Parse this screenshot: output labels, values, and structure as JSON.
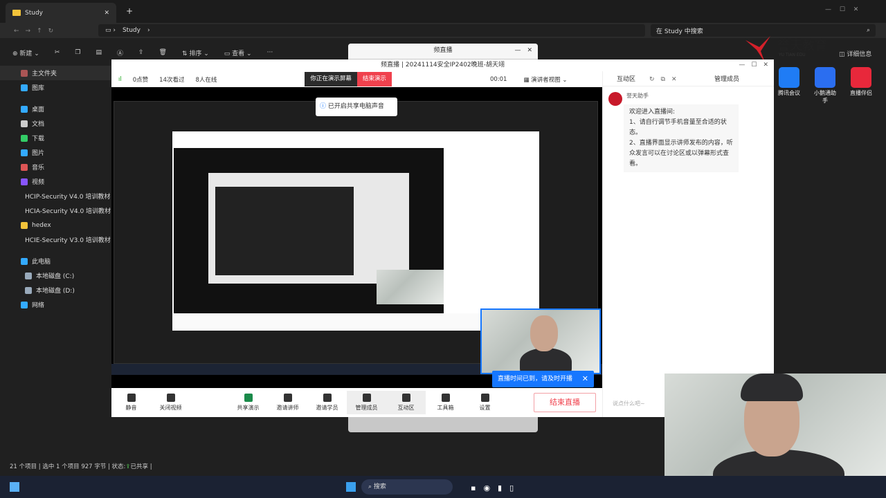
{
  "explorer": {
    "tab_title": "Study",
    "path": [
      "Study"
    ],
    "search_placeholder": "在 Study 中搜索",
    "toolbar": {
      "new": "新建",
      "sort": "排序",
      "view": "查看",
      "more": "···",
      "details": "详细信息"
    },
    "sidebar": [
      "主文件夹",
      "图库",
      "桌面",
      "文档",
      "下载",
      "图片",
      "音乐",
      "视频",
      "HCIP-Security V4.0 培训教材-PP",
      "HCIA-Security V4.0 培训教材 PP",
      "hedex",
      "HCIE-Security V3.0 培训教材-PP",
      "此电脑",
      "本地磁盘 (C:)",
      "本地磁盘 (D:)",
      "网络"
    ],
    "status": {
      "items": "21 个项目",
      "selected": "选中 1 个项目  927 字节",
      "state": "状态:",
      "shared": "已共享"
    }
  },
  "small_window": {
    "title": "频直播"
  },
  "live": {
    "title": "频直播 | 20241114安全IP2402晚班-胡天翊",
    "stats": {
      "likes": "0点赞",
      "views": "14次看过",
      "online": "8人在线"
    },
    "presenting": "你正在演示屏幕",
    "stop_presenting": "结束演示",
    "timer": "00:01",
    "view_mode": "演讲者视图",
    "share_notice": "已开启共享电脑声音",
    "toolbar": [
      {
        "label": "静音",
        "icon": "mic-icon"
      },
      {
        "label": "关闭视频",
        "icon": "camera-icon"
      },
      {
        "label": "共享演示",
        "icon": "share-screen-icon"
      },
      {
        "label": "邀请讲师",
        "icon": "invite-lecturer-icon"
      },
      {
        "label": "邀请学员",
        "icon": "invite-student-icon"
      },
      {
        "label": "管理成员",
        "icon": "members-icon"
      },
      {
        "label": "互动区",
        "icon": "chat-icon"
      },
      {
        "label": "工具箱",
        "icon": "toolbox-icon"
      },
      {
        "label": "设置",
        "icon": "gear-icon"
      }
    ],
    "end_live": "结束直播",
    "popup": "直播时间已到，请及时开播",
    "panel": {
      "tab_interact": "互动区",
      "tab_members": "管理成员",
      "sender": "誉天助手",
      "message": [
        "欢迎进入直播间:",
        "1、请自行调节手机音量至合适的状态。",
        "2、直播界面显示讲师发布的内容，听众发言可以在讨论区或以弹幕形式查看。"
      ],
      "input_placeholder": "说点什么吧~"
    }
  },
  "logo": {
    "text": "誉天教育",
    "sub": "YU TIAN EDU"
  },
  "desktop_icons": [
    {
      "label": "腾讯会议",
      "color": "#1f7cf5"
    },
    {
      "label": "小鹅通助手",
      "color": "#2b6ef0"
    },
    {
      "label": "直播伴侣",
      "color": "#e8283b"
    }
  ],
  "taskbar": {
    "search": "搜索"
  },
  "colors": {
    "accent": "#1677ff",
    "danger": "#f0414d"
  }
}
